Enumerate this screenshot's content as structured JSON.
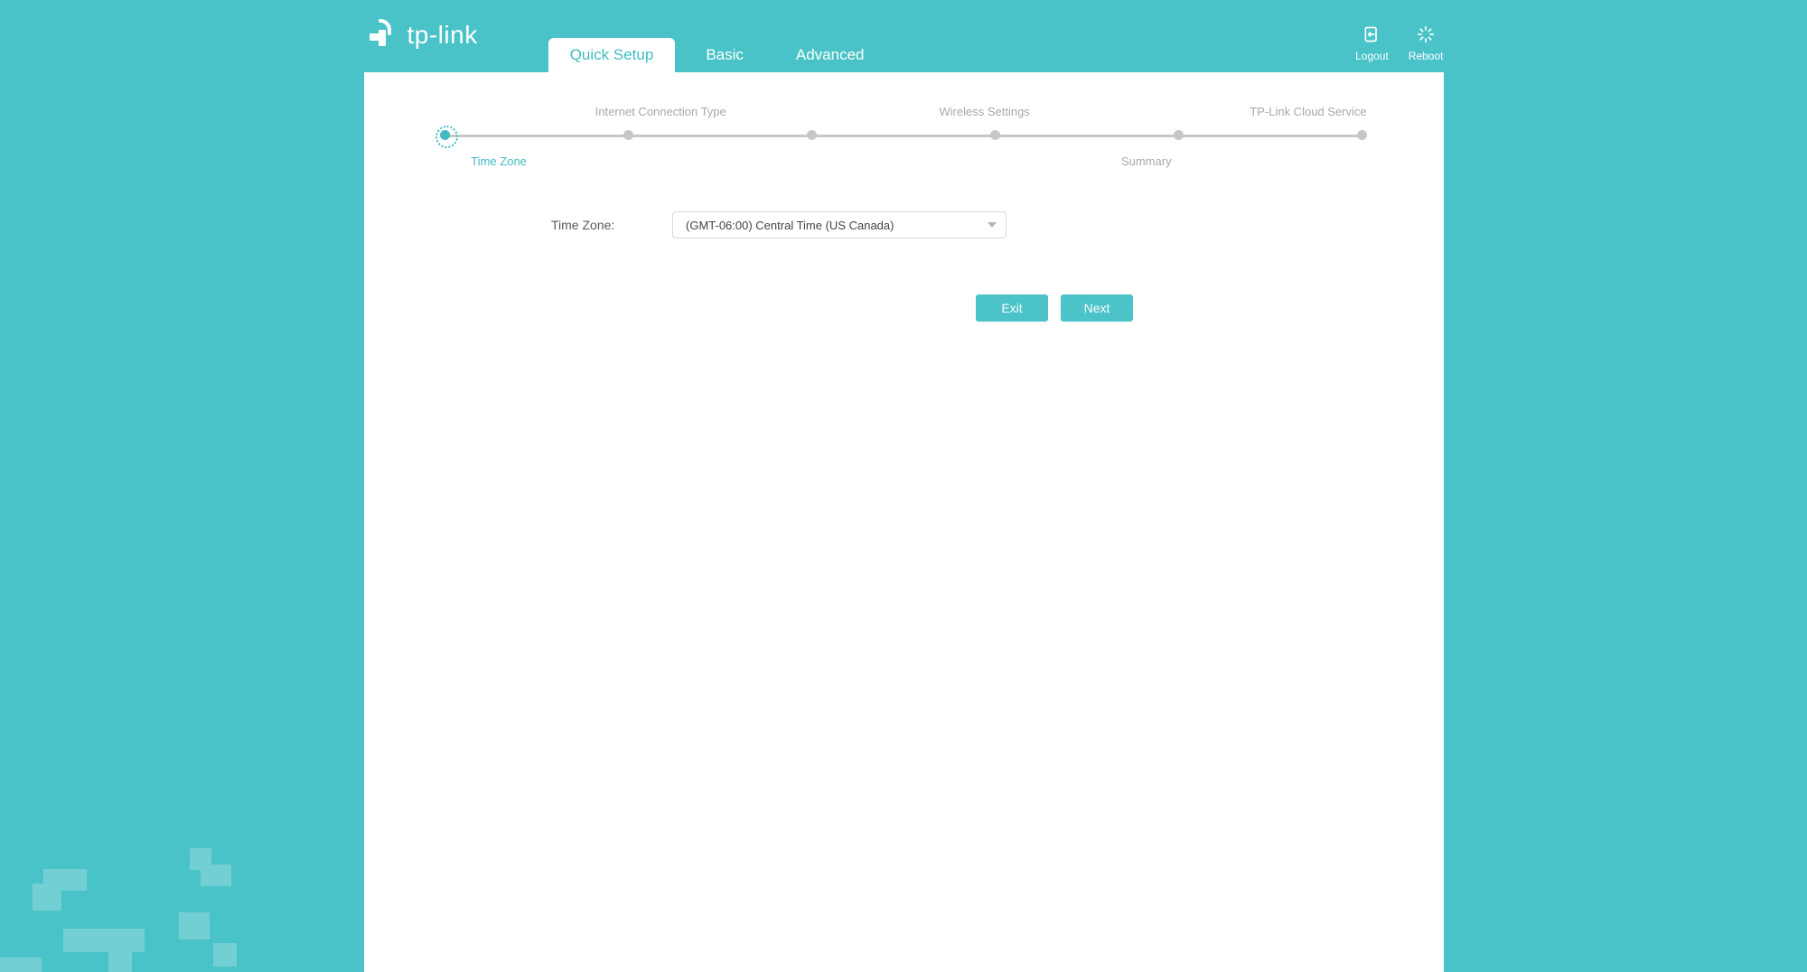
{
  "brand": "tp-link",
  "tabs": {
    "quick_setup": "Quick Setup",
    "basic": "Basic",
    "advanced": "Advanced"
  },
  "actions": {
    "logout": "Logout",
    "reboot": "Reboot"
  },
  "steps": {
    "time_zone": "Time Zone",
    "internet_connection_type": "Internet Connection Type",
    "wireless_settings": "Wireless Settings",
    "summary": "Summary",
    "cloud_service": "TP-Link Cloud Service"
  },
  "form": {
    "time_zone_label": "Time Zone:",
    "time_zone_value": "(GMT-06:00) Central Time (US Canada)"
  },
  "buttons": {
    "exit": "Exit",
    "next": "Next"
  }
}
